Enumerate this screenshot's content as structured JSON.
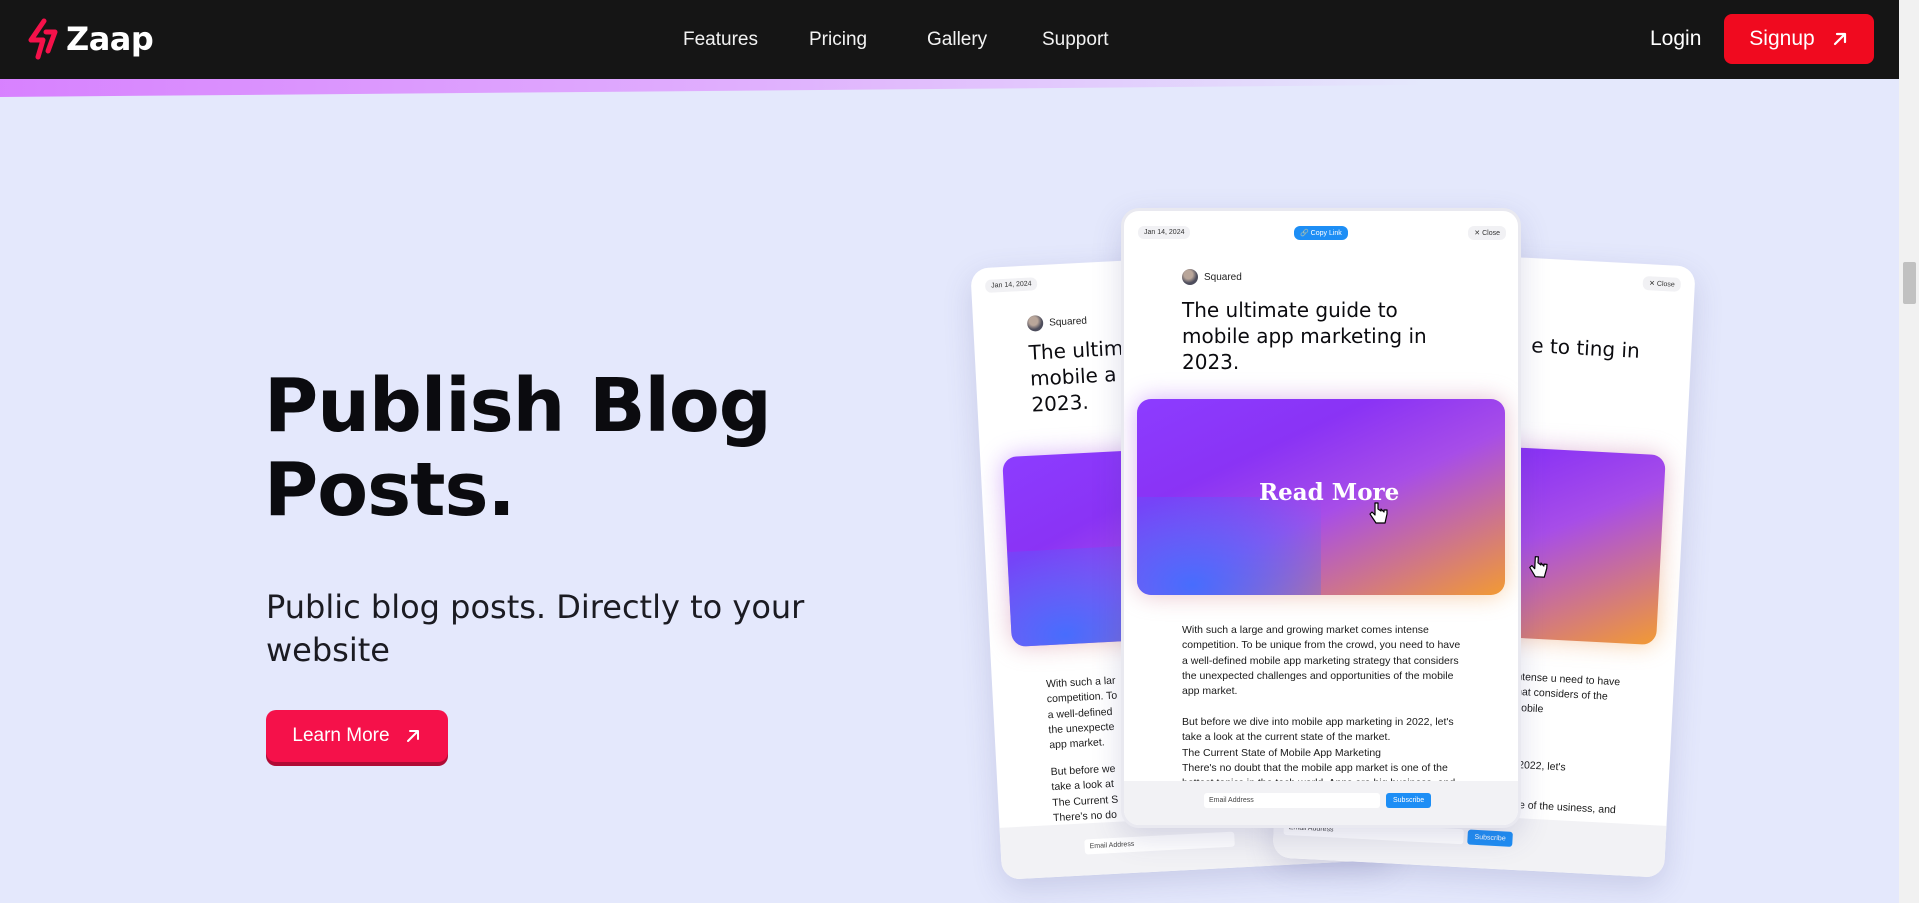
{
  "nav": {
    "brand": "Zaap",
    "links": [
      "Features",
      "Pricing",
      "Gallery",
      "Support"
    ],
    "login": "Login",
    "signup": "Signup"
  },
  "hero": {
    "title_line1": "Publish Blog",
    "title_line2": "Posts.",
    "subtitle": "Public blog posts. Directly to your website",
    "cta": "Learn More"
  },
  "preview": {
    "center": {
      "date": "Jan 14, 2024",
      "copy_link": "Copy Link",
      "close": "Close",
      "author": "Squared",
      "title": "The ultimate guide to mobile app marketing in 2023.",
      "read_more": "Read More",
      "para1": "With such a large and growing market comes intense competition. To be unique from the crowd, you need to have a well-defined mobile app marketing strategy that considers the unexpected challenges and opportunities of the mobile app market.",
      "para2": "But before we dive into mobile app marketing in 2022, let's take a look at the current state of the market.",
      "para3": "The Current State of Mobile App Marketing",
      "para4": "There's no doubt that the mobile app market is one of the hottest topics in the tech world. Apps are big business, and",
      "email_placeholder": "Email Address",
      "subscribe": "Subscribe"
    },
    "left": {
      "date": "Jan 14, 2024",
      "author": "Squared",
      "title": "The ultim mobile a 2023.",
      "para1": "With such a lar competition. To a well-defined the unexpecte app market.",
      "para2": "But before we take a look at The Current S There's no do hottest topics",
      "email_placeholder": "Email Address"
    },
    "right": {
      "close": "Close",
      "title": "e to ting in",
      "para1": "intense u need to have that considers of the mobile",
      "para2": "n 2022, let's",
      "para3": "one of the usiness, and",
      "email_placeholder": "Email Address",
      "subscribe": "Subscribe"
    }
  }
}
